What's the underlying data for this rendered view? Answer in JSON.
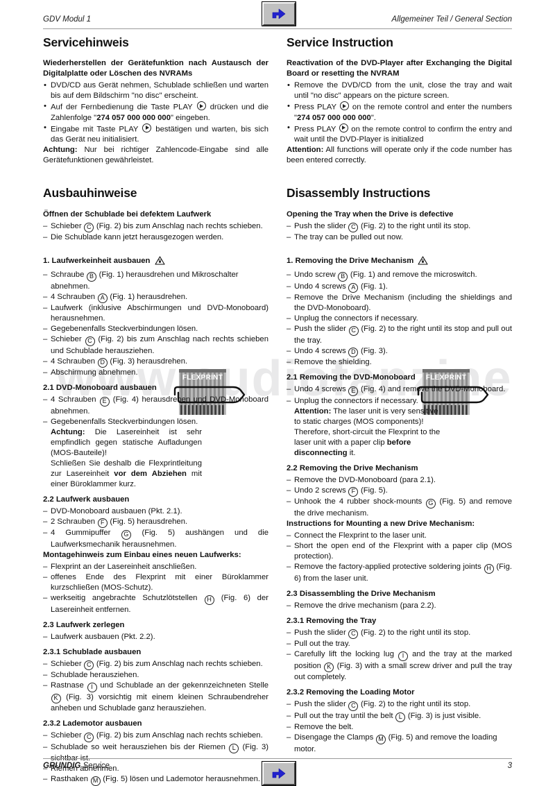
{
  "header": {
    "left": "GDV Modul 1",
    "right": "Allgemeiner Teil / General Section",
    "nav_button_icon": "back-arrow-icon"
  },
  "footer": {
    "brand": "GRUNDIG",
    "brand_suffix": " Service",
    "page_number": "3",
    "nav_button_icon": "back-arrow-icon"
  },
  "watermark": "www.audiofanzine",
  "figures": {
    "flexprint_label": "FLEXPRINT"
  },
  "left_column": {
    "section1": {
      "title": "Servicehinweis",
      "subtitle": "Wiederherstellen der Gerätefunktion nach Austausch der Digitalplatte oder Löschen des NVRAMs",
      "bullets": [
        "DVD/CD aus Gerät nehmen, Schublade schließen und warten bis auf dem Bildschirm \"no disc\" erscheint.",
        "Auf der Fernbedienung die Taste PLAY ⏵ drücken und die Zahlenfolge \"274 057 000 000 000\" eingeben.",
        "Eingabe mit Taste PLAY ⏵ bestätigen und warten, bis sich das Gerät neu initialisiert."
      ],
      "note_label": "Achtung:",
      "note_text": " Nur bei richtiger Zahlencode-Eingabe sind alle Gerätefunktionen gewährleistet."
    },
    "section2": {
      "title": "Ausbauhinweise",
      "block1": {
        "heading": "Öffnen der Schublade bei defektem Laufwerk",
        "items": [
          "Schieber ⒸT(Fig. 2) bis zum Anschlag nach rechts schieben.",
          "Die Schublade kann jetzt herausgezogen werden."
        ]
      },
      "block2": {
        "heading": "1. Laufwerkeinheit ausbauen",
        "items": [
          "Schraube Ⓑ (Fig. 1) herausdrehen und Mikroschalter abnehmen.",
          "4 Schrauben Ⓐ (Fig. 1) herausdrehen.",
          "Laufwerk (inklusive Abschirmungen und DVD-Monoboard) herausnehmen.",
          "Gegebenenfalls Steckverbindungen lösen.",
          "Schieber Ⓒ (Fig. 2) bis zum Anschlag nach rechts schieben und Schublade herausziehen.",
          "4 Schrauben Ⓓ (Fig. 3) herausdrehen.",
          "Abschirmung abnehmen."
        ]
      },
      "block3": {
        "heading": "2.1  DVD-Monoboard ausbauen",
        "items": [
          "4 Schrauben Ⓔ (Fig. 4) herausdrehen und DVD-Monoboard abnehmen.",
          "Gegebenenfalls Steckverbindungen lösen."
        ],
        "note_label": "Achtung:",
        "note_text": " Die Lasereinheit ist sehr empfindlich gegen statische Aufladungen (MOS-Bauteile)!",
        "note_text2_a": "Schließen Sie deshalb die Flexprintleitung zur Lasereinheit ",
        "note_text2_b": "vor dem Abziehen",
        "note_text2_c": " mit einer Büroklammer kurz."
      },
      "block4": {
        "heading": "2.2  Laufwerk ausbauen",
        "items": [
          "DVD-Monoboard ausbauen (Pkt. 2.1).",
          "2 Schrauben Ⓕ (Fig. 5) herausdrehen.",
          "4 Gummipuffer Ⓖ (Fig. 5) aushängen und die Laufwerksmechanik herausnehmen."
        ],
        "heading2": "Montagehinweis zum Einbau eines neuen Laufwerks:",
        "items2": [
          "Flexprint an der Lasereinheit anschließen.",
          "offenes Ende des Flexprint mit einer Büroklammer kurzschließen (MOS-Schutz).",
          "werkseitig angebrachte Schutzlötstellen Ⓗ (Fig. 6) der Lasereinheit entfernen."
        ]
      },
      "block5": {
        "heading": "2.3  Laufwerk zerlegen",
        "items": [
          "Laufwerk ausbauen (Pkt. 2.2)."
        ]
      },
      "block6": {
        "heading": "2.3.1  Schublade ausbauen",
        "items": [
          "Schieber Ⓒ (Fig. 2) bis zum Anschlag nach rechts schieben.",
          "Schublade herausziehen.",
          "Rastnase Ⓘ und Schublade an der gekennzeichneten Stelle Ⓚ (Fig. 3) vorsichtig mit einem kleinen Schraubendreher anheben und Schublade ganz herausziehen."
        ]
      },
      "block7": {
        "heading": "2.3.2  Lademotor ausbauen",
        "items": [
          "Schieber Ⓒ (Fig. 2) bis zum Anschlag nach rechts schieben.",
          "Schublade so weit herausziehen bis der Riemen Ⓛ (Fig. 3) sichtbar ist.",
          "Riemen abnehmen.",
          "Rasthaken Ⓜ (Fig. 5) lösen und Lademotor herausnehmen."
        ]
      }
    }
  },
  "right_column": {
    "section1": {
      "title": "Service Instruction",
      "subtitle": "Reactivation of the DVD-Player after Exchanging the Digital Board or resetting the NVRAM",
      "bullets": [
        "Remove the DVD/CD from the unit, close the tray and wait until \"no disc\" appears on the picture screen.",
        "Press PLAY ⏵ on the remote control and enter the numbers \"274 057 000 000 000\".",
        "Press PLAY ⏵ on the remote control to confirm the entry and wait until the DVD-Player is initialized"
      ],
      "note_label": "Attention:",
      "note_text": " All functions will operate only if the code number has been entered correctly."
    },
    "section2": {
      "title": "Disassembly Instructions",
      "block1": {
        "heading": "Opening the Tray when the Drive is defective",
        "items": [
          "Push the slider Ⓒ (Fig. 2) to the right until its stop.",
          "The tray can be pulled out now."
        ]
      },
      "block2": {
        "heading": "1. Removing the Drive Mechanism",
        "items": [
          "Undo screw Ⓑ (Fig. 1) and remove the microswitch.",
          "Undo 4 screws Ⓐ (Fig. 1).",
          "Remove the Drive Mechanism (including the shieldings and the DVD-Monoboard).",
          "Unplug the connectors if necessary.",
          "Push the slider Ⓒ (Fig. 2) to the right until its stop and pull out the tray.",
          "Undo 4 screws Ⓓ (Fig. 3).",
          "Remove the shielding."
        ]
      },
      "block3": {
        "heading": "2.1  Removing the DVD-Monoboard",
        "items": [
          "Undo 4 screws Ⓔ (Fig. 4) and remove the DVD-Monoboard.",
          "Unplug the connectors if necessary."
        ],
        "note_label": "Attention:",
        "note_text_a": " The laser unit is very sensitive to static charges (MOS components)! Therefore, short-circuit the Flexprint to the laser unit with a paper clip ",
        "note_text_b": "before disconnecting",
        "note_text_c": " it."
      },
      "block4": {
        "heading": "2.2  Removing the Drive Mechanism",
        "items": [
          "Remove the DVD-Monoboard (para 2.1).",
          "Undo 2 screws Ⓕ (Fig. 5).",
          "Unhook the 4 rubber shock-mounts Ⓖ (Fig. 5) and remove the drive mechanism."
        ],
        "heading2": "Instructions for Mounting a new Drive Mechanism:",
        "items2": [
          "Connect the Flexprint to the laser unit.",
          "Short the open end of the Flexprint with a paper clip (MOS protection).",
          "Remove the factory-applied protective soldering joints Ⓗ (Fig. 6) from the laser unit."
        ]
      },
      "block5": {
        "heading": "2.3  Disassembling the Drive Mechanism",
        "items": [
          "Remove the drive mechanism (para 2.2)."
        ]
      },
      "block6": {
        "heading": "2.3.1  Removing the Tray",
        "items": [
          "Push the slider Ⓒ (Fig. 2) to the right until its stop.",
          "Pull out the tray.",
          "Carefully lift the locking lug Ⓘ and the tray at the marked position Ⓚ (Fig. 3) with a small screw driver and pull the tray out completely."
        ]
      },
      "block7": {
        "heading": "2.3.2  Removing the Loading Motor",
        "items": [
          "Push the slider Ⓒ (Fig. 2) to the right until its stop.",
          "Pull out the tray until the belt Ⓛ (Fig. 3) is just visible.",
          "Remove the belt.",
          "Disengage the Clamps Ⓜ (Fig. 5) and remove the loading motor."
        ]
      }
    }
  }
}
